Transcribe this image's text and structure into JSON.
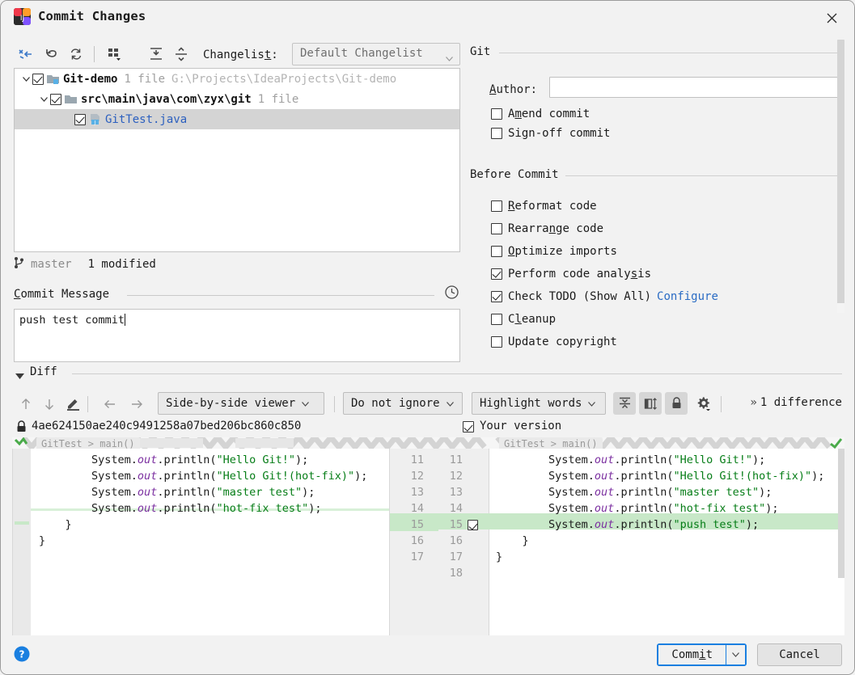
{
  "window": {
    "title": "Commit Changes",
    "app_icon": "intellij-idea-icon",
    "close_icon": "close-icon"
  },
  "changelist_toolbar": {
    "icons": [
      "show-diff-icon",
      "revert-icon",
      "refresh-icon",
      "group-by-icon",
      "expand-all-icon",
      "collapse-all-icon"
    ],
    "label": "Changelist:",
    "label_mnemonic": "t",
    "selected": "Default Changelist",
    "dropdown_icon": "chevron-down-icon"
  },
  "tree": [
    {
      "name": "Git-demo",
      "checked": true,
      "expanded": true,
      "indent": 0,
      "icon": "module-folder-icon",
      "meta": "1 file",
      "path": "G:\\Projects\\IdeaProjects\\Git-demo",
      "selected": false,
      "blue": false
    },
    {
      "name": "src\\main\\java\\com\\zyx\\git",
      "checked": true,
      "expanded": true,
      "indent": 1,
      "icon": "folder-icon",
      "meta": "1 file",
      "path": "",
      "selected": false,
      "blue": false
    },
    {
      "name": "GitTest.java",
      "checked": true,
      "expanded": null,
      "indent": 2,
      "icon": "java-file-icon",
      "meta": "",
      "path": "",
      "selected": true,
      "blue": true
    }
  ],
  "branch": {
    "icon": "branch-icon",
    "name": "master",
    "status": "1 modified"
  },
  "commit_message": {
    "label": "Commit Message",
    "label_mnemonic": "C",
    "history_icon": "clock-icon",
    "value": "push test commit"
  },
  "git_panel": {
    "title": "Git",
    "author_label": "Author:",
    "author_value": "",
    "options": [
      {
        "label": "Amend commit",
        "checked": false
      },
      {
        "label": "Sign-off commit",
        "checked": false
      }
    ]
  },
  "before_commit": {
    "title": "Before Commit",
    "options": [
      {
        "label": "Reformat code",
        "checked": false,
        "link": ""
      },
      {
        "label": "Rearrange code",
        "checked": false,
        "link": ""
      },
      {
        "label": "Optimize imports",
        "checked": false,
        "link": ""
      },
      {
        "label": "Perform code analysis",
        "checked": true,
        "link": ""
      },
      {
        "label": "Check TODO (Show All)",
        "checked": true,
        "link": "Configure"
      },
      {
        "label": "Cleanup",
        "checked": false,
        "link": ""
      },
      {
        "label": "Update copyright",
        "checked": false,
        "link": ""
      }
    ]
  },
  "diff": {
    "section_title": "Diff",
    "collapse_icon": "triangle-down-icon",
    "nav_icons": [
      "arrow-up-icon",
      "arrow-down-icon",
      "edit-pencil-icon",
      "arrow-left-icon",
      "arrow-right-icon"
    ],
    "viewer_mode": "Side-by-side viewer",
    "ignore_mode": "Do not ignore",
    "highlight_mode": "Highlight words",
    "toggle_icons": [
      "collapse-unchanged-icon",
      "compare-side-icon",
      "lock-icon",
      "settings-gear-icon"
    ],
    "difference_count": "1 difference",
    "difference_chevron": "»",
    "left_title_icon": "lock-icon",
    "left_revision": "4ae624150ae240c9491258a07bed206bc860c850",
    "right_title": "Your version",
    "right_checked": true,
    "left_breadcrumb": "GitTest > main()",
    "right_breadcrumb": "GitTest > main()",
    "left_lines": [
      {
        "num": "11",
        "parts": [
          {
            "t": "        System.",
            "c": "sys"
          },
          {
            "t": "out",
            "c": "fld"
          },
          {
            "t": ".println(",
            "c": "sys"
          },
          {
            "t": "\"Hello Git!\"",
            "c": "str"
          },
          {
            "t": ");",
            "c": "sys"
          }
        ]
      },
      {
        "num": "12",
        "parts": [
          {
            "t": "        System.",
            "c": "sys"
          },
          {
            "t": "out",
            "c": "fld"
          },
          {
            "t": ".println(",
            "c": "sys"
          },
          {
            "t": "\"Hello Git!(hot-fix)\"",
            "c": "str"
          },
          {
            "t": ");",
            "c": "sys"
          }
        ]
      },
      {
        "num": "13",
        "parts": [
          {
            "t": "        System.",
            "c": "sys"
          },
          {
            "t": "out",
            "c": "fld"
          },
          {
            "t": ".println(",
            "c": "sys"
          },
          {
            "t": "\"master test\"",
            "c": "str"
          },
          {
            "t": ");",
            "c": "sys"
          }
        ]
      },
      {
        "num": "14",
        "parts": [
          {
            "t": "        System.",
            "c": "sys"
          },
          {
            "t": "out",
            "c": "fld"
          },
          {
            "t": ".println(",
            "c": "sys"
          },
          {
            "t": "\"hot-fix test\"",
            "c": "str"
          },
          {
            "t": ");",
            "c": "sys"
          }
        ]
      },
      {
        "num": "15",
        "parts": [
          {
            "t": "    }",
            "c": "br"
          }
        ]
      },
      {
        "num": "16",
        "parts": [
          {
            "t": "}",
            "c": "br"
          }
        ]
      },
      {
        "num": "17",
        "parts": []
      }
    ],
    "right_lines": [
      {
        "num": "11",
        "num2": "11",
        "marker": false,
        "changed": false,
        "parts": [
          {
            "t": "        System.",
            "c": "sys"
          },
          {
            "t": "out",
            "c": "fld"
          },
          {
            "t": ".println(",
            "c": "sys"
          },
          {
            "t": "\"Hello Git!\"",
            "c": "str"
          },
          {
            "t": ");",
            "c": "sys"
          }
        ]
      },
      {
        "num": "12",
        "num2": "12",
        "marker": false,
        "changed": false,
        "parts": [
          {
            "t": "        System.",
            "c": "sys"
          },
          {
            "t": "out",
            "c": "fld"
          },
          {
            "t": ".println(",
            "c": "sys"
          },
          {
            "t": "\"Hello Git!(hot-fix)\"",
            "c": "str"
          },
          {
            "t": ");",
            "c": "sys"
          }
        ]
      },
      {
        "num": "13",
        "num2": "13",
        "marker": false,
        "changed": false,
        "parts": [
          {
            "t": "        System.",
            "c": "sys"
          },
          {
            "t": "out",
            "c": "fld"
          },
          {
            "t": ".println(",
            "c": "sys"
          },
          {
            "t": "\"master test\"",
            "c": "str"
          },
          {
            "t": ");",
            "c": "sys"
          }
        ]
      },
      {
        "num": "14",
        "num2": "14",
        "marker": false,
        "changed": false,
        "parts": [
          {
            "t": "        System.",
            "c": "sys"
          },
          {
            "t": "out",
            "c": "fld"
          },
          {
            "t": ".println(",
            "c": "sys"
          },
          {
            "t": "\"hot-fix test\"",
            "c": "str"
          },
          {
            "t": ");",
            "c": "sys"
          }
        ]
      },
      {
        "num": "15",
        "num2": "15",
        "marker": true,
        "changed": true,
        "parts": [
          {
            "t": "        System.",
            "c": "sys"
          },
          {
            "t": "out",
            "c": "fld"
          },
          {
            "t": ".println(",
            "c": "sys"
          },
          {
            "t": "\"push test\"",
            "c": "str"
          },
          {
            "t": ");",
            "c": "sys"
          }
        ]
      },
      {
        "num": "16",
        "num2": "16",
        "marker": false,
        "changed": false,
        "parts": [
          {
            "t": "    }",
            "c": "br"
          }
        ]
      },
      {
        "num": "17",
        "num2": "17",
        "marker": false,
        "changed": false,
        "parts": [
          {
            "t": "}",
            "c": "br"
          }
        ]
      },
      {
        "num": "",
        "num2": "18",
        "marker": false,
        "changed": false,
        "parts": []
      }
    ]
  },
  "footer": {
    "help_icon": "help-circle-icon",
    "commit_label": "Commit",
    "commit_dropdown_icon": "chevron-down-icon",
    "cancel_label": "Cancel"
  },
  "colors": {
    "accent_blue": "#1a7fe0",
    "link_blue": "#2b6cc4",
    "diff_added": "#c8e8c8",
    "string_green": "#067d17",
    "field_purple": "#7b2fa0",
    "window_bg": "#f2f2f2"
  }
}
